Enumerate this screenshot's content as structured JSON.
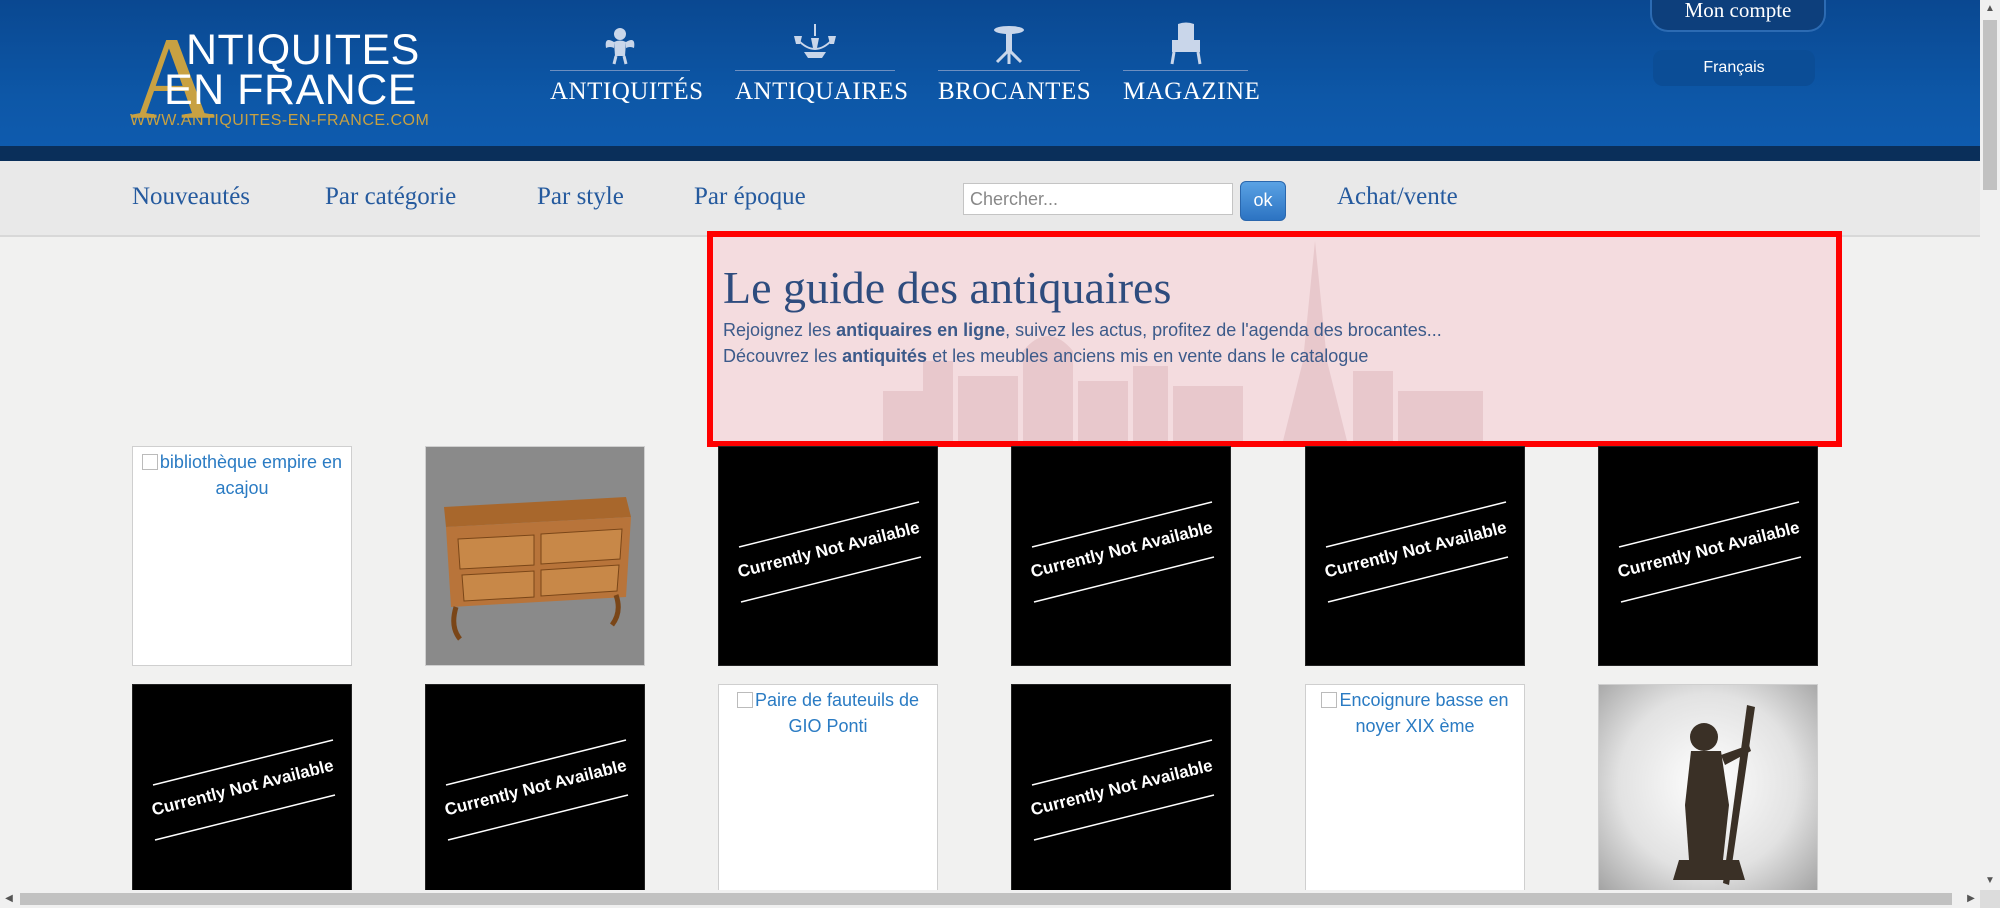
{
  "logo": {
    "big_letter": "A",
    "line1": "NTIQUITES",
    "line2": "EN FRANCE",
    "url": "WWW.ANTIQUITES-EN-FRANCE.COM"
  },
  "main_nav": [
    {
      "label": "ANTIQUITÉS",
      "icon": "cherub-icon"
    },
    {
      "label": "ANTIQUAIRES",
      "icon": "chandelier-icon"
    },
    {
      "label": "BROCANTES",
      "icon": "table-icon"
    },
    {
      "label": "MAGAZINE",
      "icon": "armchair-icon"
    }
  ],
  "account": {
    "label": "Mon compte"
  },
  "language": {
    "label": "Français"
  },
  "sub_nav": {
    "items": [
      "Nouveautés",
      "Par catégorie",
      "Par style",
      "Par époque"
    ],
    "search_placeholder": "Chercher...",
    "search_button": "ok",
    "buy_sell": "Achat/vente"
  },
  "hero": {
    "title": "Le guide des antiquaires",
    "line1_pre": "Rejoignez les ",
    "line1_bold": "antiquaires en ligne",
    "line1_post": ", suivez les actus, profitez de l'agenda des brocantes...",
    "line2_pre": "Découvrez les ",
    "line2_bold": "antiquités",
    "line2_post": " et les meubles anciens mis en vente dans le catalogue"
  },
  "tiles": {
    "unavailable_text": "Currently Not Available",
    "row1": [
      {
        "kind": "alt",
        "alt": "bibliothèque empire en acajou"
      },
      {
        "kind": "image",
        "subject": "commode"
      },
      {
        "kind": "unavailable"
      },
      {
        "kind": "unavailable"
      },
      {
        "kind": "unavailable"
      },
      {
        "kind": "unavailable"
      }
    ],
    "row2": [
      {
        "kind": "unavailable"
      },
      {
        "kind": "unavailable"
      },
      {
        "kind": "alt",
        "alt": "Paire de fauteuils de GIO Ponti"
      },
      {
        "kind": "unavailable"
      },
      {
        "kind": "alt",
        "alt": "Encoignure basse en noyer XIX ème"
      },
      {
        "kind": "image",
        "subject": "bronze-statue"
      }
    ]
  },
  "colors": {
    "header_blue": "#0d57a7",
    "gold": "#c8a142",
    "link_blue": "#255a9e",
    "highlight_red": "#ff0000"
  }
}
